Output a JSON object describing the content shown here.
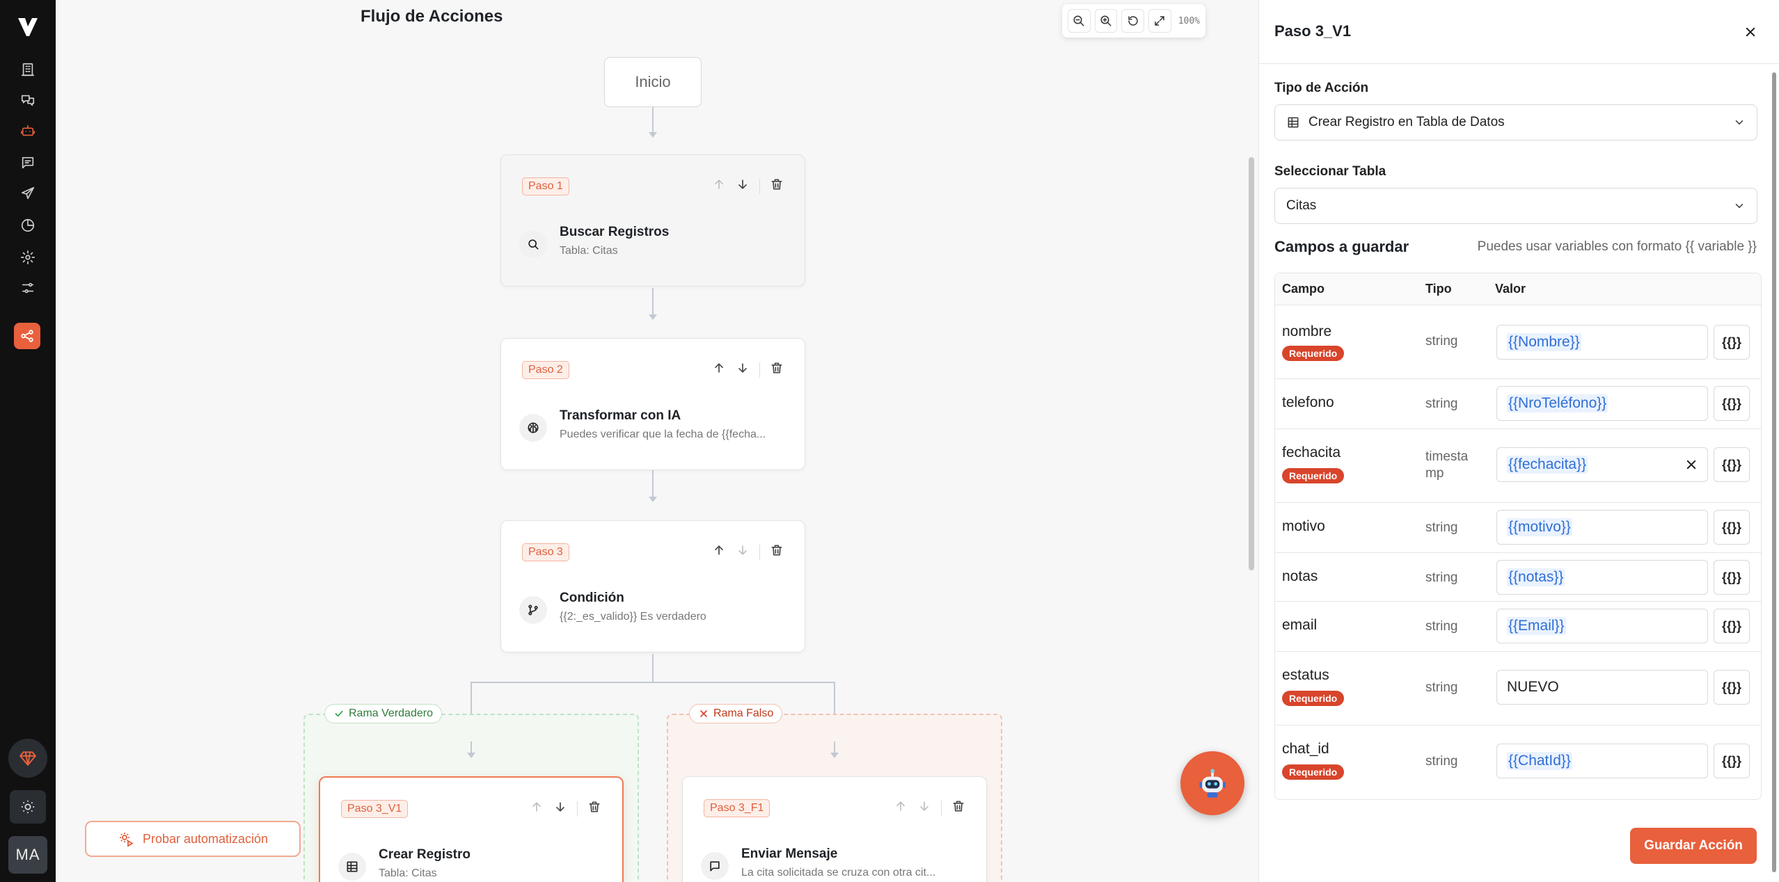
{
  "nav": {
    "items": [
      {
        "icon": "building-icon",
        "active": false
      },
      {
        "icon": "chat-bubbles-icon",
        "active": false
      },
      {
        "icon": "robot-icon",
        "active": true
      },
      {
        "icon": "message-square-icon",
        "active": false
      },
      {
        "icon": "send-icon",
        "active": false
      },
      {
        "icon": "pie-chart-icon",
        "active": false
      },
      {
        "icon": "gear-icon",
        "active": false
      },
      {
        "icon": "sliders-icon",
        "active": false
      }
    ],
    "avatar_initials": "MA"
  },
  "canvas": {
    "title": "Flujo de Acciones",
    "zoom_level": "100%",
    "start_label": "Inicio",
    "steps": [
      {
        "badge": "Paso 1",
        "title": "Buscar Registros",
        "subtitle": "Tabla: Citas",
        "icon": "search-icon"
      },
      {
        "badge": "Paso 2",
        "title": "Transformar con IA",
        "subtitle": "Puedes verificar que la fecha de {{fecha...",
        "icon": "brain-icon"
      },
      {
        "badge": "Paso 3",
        "title": "Condición",
        "subtitle": "{{2:_es_valido}} Es verdadero",
        "icon": "git-branch-icon"
      }
    ],
    "branches": {
      "true_label": "Rama Verdadero",
      "false_label": "Rama Falso",
      "true_step": {
        "badge": "Paso 3_V1",
        "title": "Crear Registro",
        "subtitle": "Tabla: Citas",
        "icon": "table-icon"
      },
      "false_step": {
        "badge": "Paso 3_F1",
        "title": "Enviar Mensaje",
        "subtitle": "La cita solicitada se cruza con otra cit...",
        "icon": "message-icon"
      }
    },
    "test_button": "Probar automatización"
  },
  "panel": {
    "title": "Paso 3_V1",
    "action_type_label": "Tipo de Acción",
    "action_type_value": "Crear Registro en Tabla de Datos",
    "table_label": "Seleccionar Tabla",
    "table_value": "Citas",
    "fields_title": "Campos a guardar",
    "fields_hint": "Puedes usar variables con formato {{ variable }}",
    "columns": {
      "campo": "Campo",
      "tipo": "Tipo",
      "valor": "Valor"
    },
    "required_label": "Requerido",
    "var_button": "{{}}",
    "fields": [
      {
        "name": "nombre",
        "type": "string",
        "value": "{{Nombre}}",
        "required": true
      },
      {
        "name": "telefono",
        "type": "string",
        "value": "{{NroTeléfono}}",
        "required": false
      },
      {
        "name": "fechacita",
        "type": "timestamp",
        "type_line1": "timesta",
        "type_line2": "mp",
        "value": "{{fechacita}}",
        "required": true,
        "clearable": true
      },
      {
        "name": "motivo",
        "type": "string",
        "value": "{{motivo}}",
        "required": false
      },
      {
        "name": "notas",
        "type": "string",
        "value": "{{notas}}",
        "required": false
      },
      {
        "name": "email",
        "type": "string",
        "value": "{{Email}}",
        "required": false
      },
      {
        "name": "estatus",
        "type": "string",
        "value": "NUEVO",
        "required": true
      },
      {
        "name": "chat_id",
        "type": "string",
        "value": "{{ChatId}}",
        "required": true
      }
    ],
    "save_button": "Guardar Acción"
  },
  "colors": {
    "accent": "#e8603c",
    "nav_bg": "#111111",
    "token": "#2f6fd6",
    "required": "#d8452b"
  }
}
